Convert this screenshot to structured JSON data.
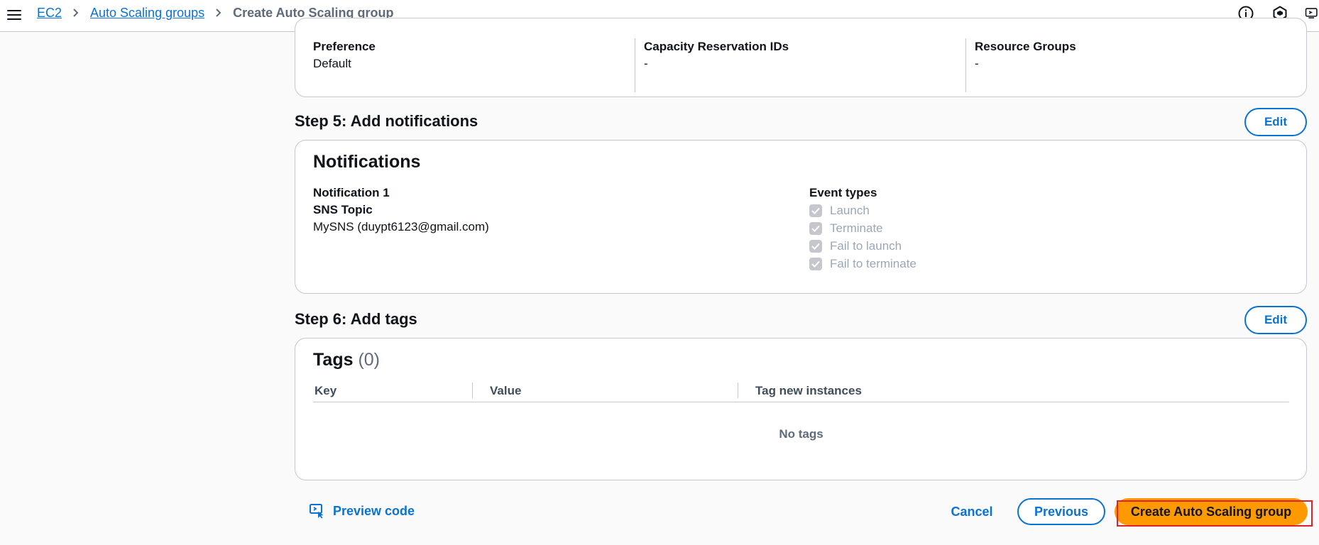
{
  "topbar": {
    "menu_icon": "hamburger-menu-icon",
    "breadcrumb": {
      "items": [
        {
          "label": "EC2"
        },
        {
          "label": "Auto Scaling groups"
        }
      ],
      "current": "Create Auto Scaling group"
    },
    "icons": [
      "info-icon",
      "feedback-icon",
      "preview-screen-icon"
    ]
  },
  "preferences": {
    "columns": [
      {
        "label": "Preference",
        "value": "Default"
      },
      {
        "label": "Capacity Reservation IDs",
        "value": "-"
      },
      {
        "label": "Resource Groups",
        "value": "-"
      }
    ]
  },
  "step5": {
    "header": "Step 5: Add notifications",
    "edit_label": "Edit",
    "title": "Notifications",
    "notification_name": "Notification 1",
    "sns_topic_label": "SNS Topic",
    "sns_topic_value": "MySNS (duypt6123@gmail.com)",
    "event_types_label": "Event types",
    "event_types": [
      {
        "label": "Launch",
        "checked": true
      },
      {
        "label": "Terminate",
        "checked": true
      },
      {
        "label": "Fail to launch",
        "checked": true
      },
      {
        "label": "Fail to terminate",
        "checked": true
      }
    ]
  },
  "step6": {
    "header": "Step 6: Add tags",
    "edit_label": "Edit",
    "title": "Tags",
    "count": "(0)",
    "columns": [
      "Key",
      "Value",
      "Tag new instances"
    ],
    "empty_text": "No tags"
  },
  "actions": {
    "preview_code": "Preview code",
    "cancel": "Cancel",
    "previous": "Previous",
    "create": "Create Auto Scaling group"
  },
  "colors": {
    "link": "#0972d3",
    "primary_button": "#ff9900",
    "highlight": "#e0202a",
    "border": "#c6c6cd",
    "page_bg": "#fafafa"
  }
}
